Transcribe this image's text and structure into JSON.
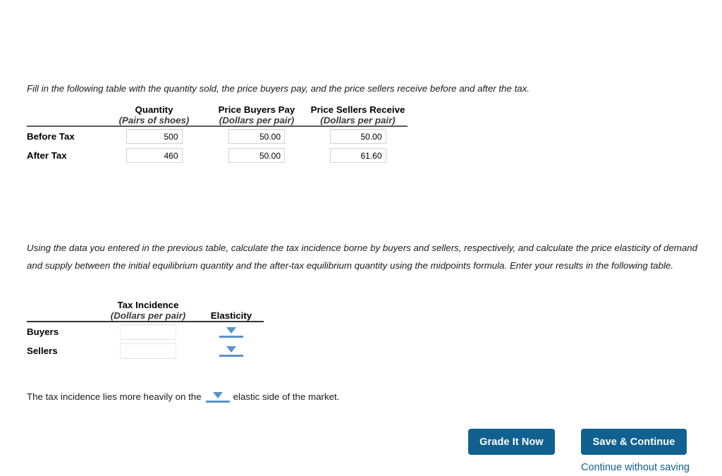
{
  "prompts": {
    "fill_table": "Fill in the following table with the quantity sold, the price buyers pay, and the price sellers receive before and after the tax.",
    "calculate": "Using the data you entered in the previous table, calculate the tax incidence borne by buyers and sellers, respectively, and calculate the price elasticity of demand and supply between the initial equilibrium quantity and the after-tax equilibrium quantity using the midpoints formula. Enter your results in the following table."
  },
  "table_before_after": {
    "columns": [
      {
        "title": "",
        "unit": ""
      },
      {
        "title": "Quantity",
        "unit": "(Pairs of shoes)"
      },
      {
        "title": "Price Buyers Pay",
        "unit": "(Dollars per pair)"
      },
      {
        "title": "Price Sellers Receive",
        "unit": "(Dollars per pair)"
      }
    ],
    "rows": [
      {
        "label": "Before Tax",
        "quantity": "500",
        "price_buyers_pay": "50.00",
        "price_sellers_receive": "50.00"
      },
      {
        "label": "After Tax",
        "quantity": "460",
        "price_buyers_pay": "50.00",
        "price_sellers_receive": "61.60"
      }
    ]
  },
  "table_incidence": {
    "columns": [
      {
        "title": "",
        "unit": ""
      },
      {
        "title": "Tax Incidence",
        "unit": "(Dollars per pair)"
      },
      {
        "title": "Elasticity",
        "unit": ""
      }
    ],
    "rows": [
      {
        "label": "Buyers",
        "tax_incidence": "",
        "elasticity": ""
      },
      {
        "label": "Sellers",
        "tax_incidence": "",
        "elasticity": ""
      }
    ]
  },
  "closing_sentence": {
    "before": "The tax incidence lies more heavily on the",
    "after": "elastic side of the market.",
    "dropdown_value": ""
  },
  "actions": {
    "grade_label": "Grade It Now",
    "save_label": "Save & Continue",
    "continue_without_saving_label": "Continue without saving"
  },
  "colors": {
    "button_blue": "#10618f",
    "dropdown_blue": "#5b92c8",
    "rule_gray": "#5a5a5a"
  }
}
